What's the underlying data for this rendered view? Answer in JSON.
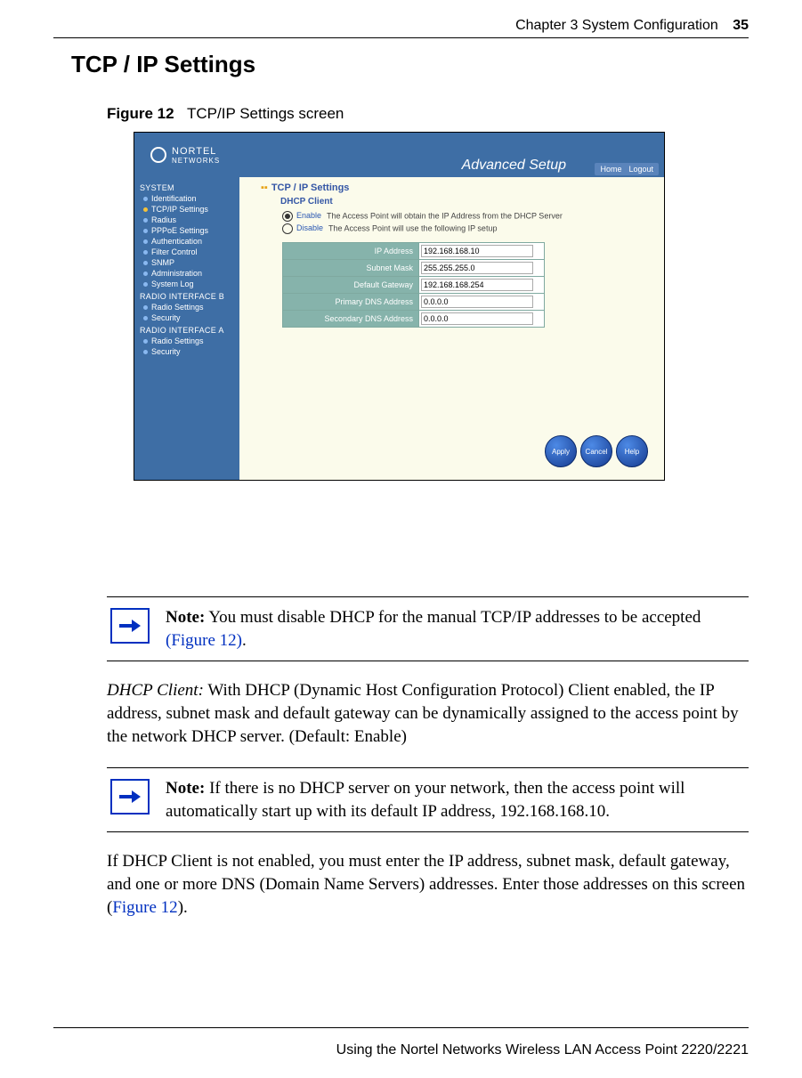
{
  "header": {
    "chapter": "Chapter 3  System Configuration",
    "page_num": "35"
  },
  "h1": "TCP / IP Settings",
  "figure": {
    "label": "Figure 12",
    "caption": "TCP/IP Settings screen",
    "brand_top": "NORTEL",
    "brand_bottom": "NETWORKS",
    "banner": "Advanced Setup",
    "home_link": "Home",
    "logout_link": "Logout",
    "sidebar": {
      "g1": "SYSTEM",
      "g1_items": [
        "Identification",
        "TCP/IP Settings",
        "Radius",
        "PPPoE Settings",
        "Authentication",
        "Filter Control",
        "SNMP",
        "Administration",
        "System Log"
      ],
      "g2": "RADIO INTERFACE B",
      "g2_items": [
        "Radio Settings",
        "Security"
      ],
      "g3": "RADIO INTERFACE A",
      "g3_items": [
        "Radio Settings",
        "Security"
      ]
    },
    "page_title": "TCP / IP Settings",
    "section": "DHCP Client",
    "opt_enable": "Enable",
    "opt_enable_desc": "The Access Point  will obtain the IP Address from the DHCP Server",
    "opt_disable": "Disable",
    "opt_disable_desc": "The Access Point will use the following IP setup",
    "fields": {
      "ip_k": "IP Address",
      "ip_v": "192.168.168.10",
      "sm_k": "Subnet Mask",
      "sm_v": "255.255.255.0",
      "gw_k": "Default Gateway",
      "gw_v": "192.168.168.254",
      "d1_k": "Primary DNS Address",
      "d1_v": "0.0.0.0",
      "d2_k": "Secondary DNS Address",
      "d2_v": "0.0.0.0"
    },
    "btn_apply": "Apply",
    "btn_cancel": "Cancel",
    "btn_help": "Help"
  },
  "note1": {
    "label": "Note:",
    "body": " You must disable DHCP for the manual TCP/IP addresses to be accepted ",
    "xref": "(Figure 12)",
    "tail": "."
  },
  "para1": {
    "term": "DHCP Client:",
    "body": " With DHCP (Dynamic Host Configuration Protocol) Client enabled, the IP address, subnet mask and default gateway can be dynamically assigned to the access point by the network DHCP server. (Default: Enable)"
  },
  "note2": {
    "label": "Note:",
    "body": " If there is no DHCP server on your network, then the access point will automatically start up with its default IP address, 192.168.168.10."
  },
  "para2": {
    "body_a": "If DHCP Client is not enabled, you must enter the IP address, subnet mask, default gateway, and one or more DNS (Domain Name Servers) addresses. Enter those addresses on this screen (",
    "xref": "Figure 12",
    "body_b": ")."
  },
  "footer": "Using the Nortel Networks Wireless LAN Access Point 2220/2221"
}
